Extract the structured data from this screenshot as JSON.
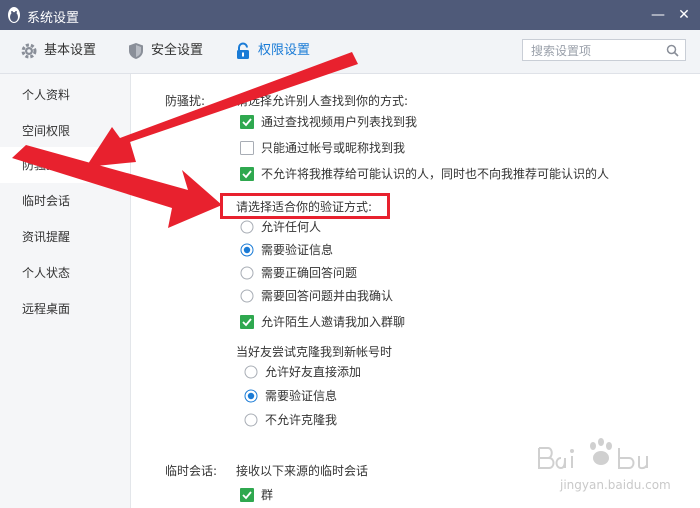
{
  "window": {
    "title": "系统设置",
    "minimize_symbol": "—",
    "close_symbol": "✕",
    "logo_icon": "penguin-icon"
  },
  "toolbar": {
    "tabs": [
      {
        "label": "基本设置",
        "icon": "gear-icon",
        "active": false
      },
      {
        "label": "安全设置",
        "icon": "shield-icon",
        "active": false
      },
      {
        "label": "权限设置",
        "icon": "lock-icon",
        "active": true
      }
    ],
    "search": {
      "placeholder": "搜索设置项",
      "value": ""
    }
  },
  "sidebar": {
    "items": [
      {
        "label": "个人资料",
        "active": false
      },
      {
        "label": "空间权限",
        "active": false
      },
      {
        "label": "防骚扰",
        "active": true
      },
      {
        "label": "临时会话",
        "active": false
      },
      {
        "label": "资讯提醒",
        "active": false
      },
      {
        "label": "个人状态",
        "active": false
      },
      {
        "label": "远程桌面",
        "active": false
      }
    ]
  },
  "anti_harass": {
    "section_label": "防骚扰:",
    "find_heading": "请选择允许别人查找到你的方式:",
    "find_options": [
      {
        "label": "通过查找视频用户列表找到我",
        "checked": true
      },
      {
        "label": "只能通过帐号或昵称找到我",
        "checked": false
      },
      {
        "label": "不允许将我推荐给可能认识的人，同时也不向我推荐可能认识的人",
        "checked": true
      }
    ],
    "verify_heading": "请选择适合你的验证方式:",
    "verify_options": [
      {
        "label": "允许任何人",
        "selected": false
      },
      {
        "label": "需要验证信息",
        "selected": true
      },
      {
        "label": "需要正确回答问题",
        "selected": false
      },
      {
        "label": "需要回答问题并由我确认",
        "selected": false
      }
    ],
    "group_invite": {
      "label": "允许陌生人邀请我加入群聊",
      "checked": true
    },
    "clone_heading": "当好友尝试克隆我到新帐号时",
    "clone_options": [
      {
        "label": "允许好友直接添加",
        "selected": false
      },
      {
        "label": "需要验证信息",
        "selected": true
      },
      {
        "label": "不允许克隆我",
        "selected": false
      }
    ]
  },
  "temp_session": {
    "section_label": "临时会话:",
    "heading": "接收以下来源的临时会话",
    "options": [
      {
        "label": "群",
        "checked": true
      }
    ]
  },
  "watermark": {
    "url": "jingyan.baidu.com"
  },
  "colors": {
    "titlebar": "#4f5a79",
    "accent": "#1a7bd6",
    "checkbox_green": "#2fa84f",
    "annotation_red": "#e8212e"
  }
}
